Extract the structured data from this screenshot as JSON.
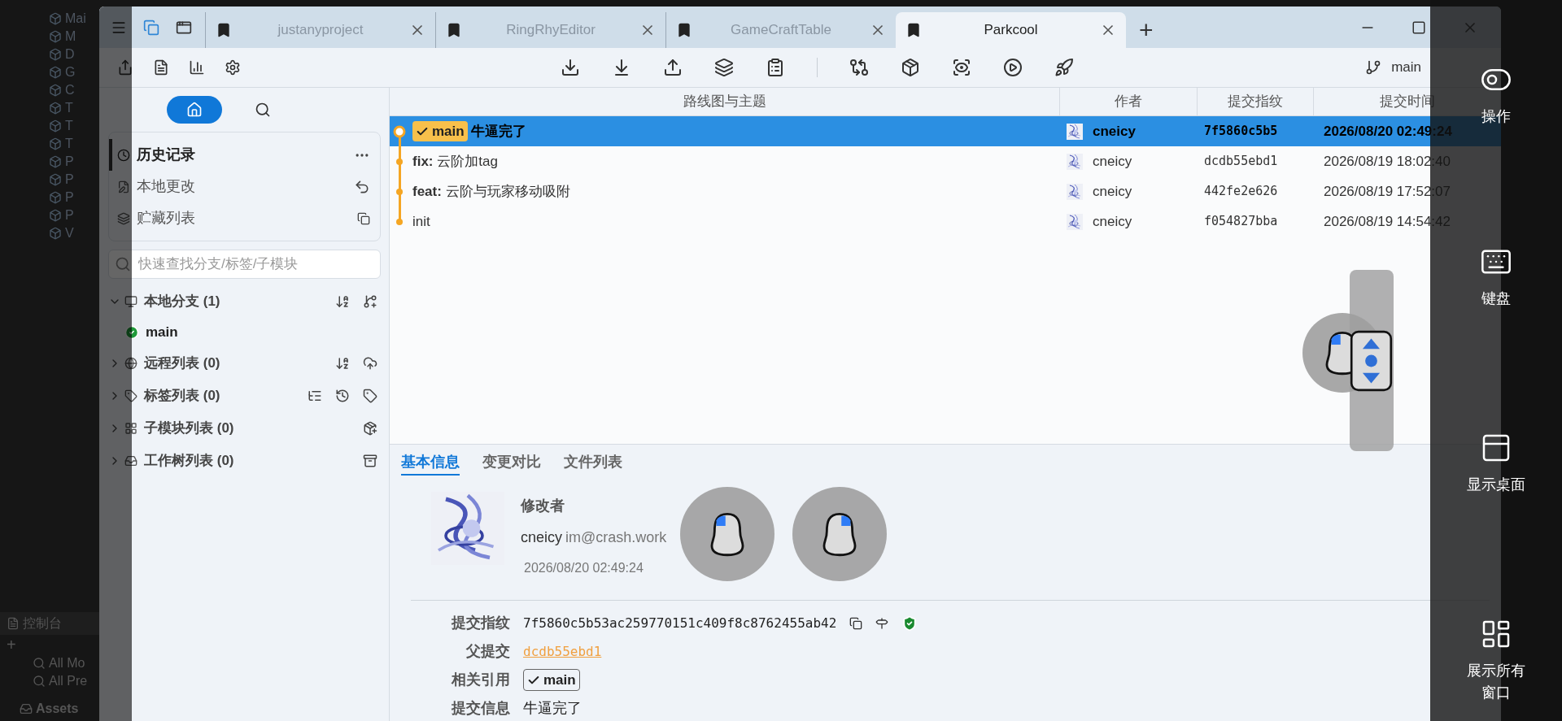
{
  "background_app": {
    "hierarchy": [
      "Mai",
      "M",
      "D",
      "G",
      "C",
      "T",
      "T",
      "T",
      "P",
      "P",
      "P",
      "P",
      "V"
    ],
    "console_tab": "控制台",
    "add_button": "+",
    "search_filters": [
      "All Mo",
      "All Pre"
    ],
    "assets_folder": "Assets"
  },
  "window": {
    "tabs": [
      {
        "label": "justanyproject",
        "selected": false
      },
      {
        "label": "RingRhyEditor",
        "selected": false
      },
      {
        "label": "GameCraftTable",
        "selected": false
      },
      {
        "label": "Parkcool",
        "selected": true
      }
    ],
    "new_tab": "+"
  },
  "toolbar": {
    "branch": "main"
  },
  "sidebar": {
    "nav": [
      {
        "kind": "home",
        "selected": true
      },
      {
        "kind": "search",
        "selected": false
      }
    ],
    "views": [
      {
        "kind": "history",
        "label": "历史记录",
        "selected": true
      },
      {
        "kind": "changes",
        "label": "本地更改",
        "selected": false
      },
      {
        "kind": "stashes",
        "label": "贮藏列表",
        "selected": false
      }
    ],
    "search": {
      "placeholder": "快速查找分支/标签/子模块"
    },
    "groups": [
      {
        "kind": "branches",
        "label": "本地分支 (1)",
        "expanded": true,
        "children": [
          {
            "label": "main",
            "current": true
          }
        ]
      },
      {
        "kind": "remotes",
        "label": "远程列表 (0)",
        "expanded": false
      },
      {
        "kind": "tags",
        "label": "标签列表 (0)",
        "expanded": false
      },
      {
        "kind": "submodules",
        "label": "子模块列表 (0)",
        "expanded": false
      },
      {
        "kind": "worktrees",
        "label": "工作树列表 (0)",
        "expanded": false
      }
    ]
  },
  "commits": {
    "columns": [
      "路线图与主题",
      "作者",
      "提交指纹",
      "提交时间"
    ],
    "rows": [
      {
        "refs": [
          "main"
        ],
        "subject": "牛逼完了",
        "author": "cneicy",
        "sha": "7f5860c5b5",
        "time": "2026/08/20 02:49:24",
        "selected": true,
        "head": true
      },
      {
        "refs": [],
        "subject": "**fix:** 云阶加tag",
        "author": "cneicy",
        "sha": "dcdb55ebd1",
        "time": "2026/08/19 18:02:40",
        "selected": false,
        "head": false
      },
      {
        "refs": [],
        "subject": "**feat:** 云阶与玩家移动吸附",
        "author": "cneicy",
        "sha": "442fe2e626",
        "time": "2026/08/19 17:52:07",
        "selected": false,
        "head": false
      },
      {
        "refs": [],
        "subject": "init",
        "author": "cneicy",
        "sha": "f054827bba",
        "time": "2026/08/19 14:54:42",
        "selected": false,
        "head": false
      }
    ]
  },
  "details": {
    "tabs": [
      {
        "label": "基本信息",
        "selected": true
      },
      {
        "label": "变更对比",
        "selected": false
      },
      {
        "label": "文件列表",
        "selected": false
      }
    ],
    "author_label": "修改者",
    "author": "cneicy",
    "email": "im@crash.work",
    "date": "2026/08/20 02:49:24",
    "fields": [
      {
        "kind": "sha",
        "label": "提交指纹",
        "value": "7f5860c5b53ac259770151c409f8c8762455ab42"
      },
      {
        "kind": "link",
        "label": "父提交",
        "value": "dcdb55ebd1"
      },
      {
        "kind": "ref",
        "label": "相关引用",
        "value": "main"
      },
      {
        "kind": "text",
        "label": "提交信息",
        "value": "牛逼完了"
      }
    ]
  },
  "overlay_panel": {
    "items": [
      {
        "kind": "toggle",
        "label": "操作"
      },
      {
        "kind": "keyboard",
        "label": "键盘"
      },
      {
        "kind": "desktop",
        "label": "显示桌面"
      },
      {
        "kind": "windows",
        "label": "展示所有窗口"
      }
    ]
  }
}
